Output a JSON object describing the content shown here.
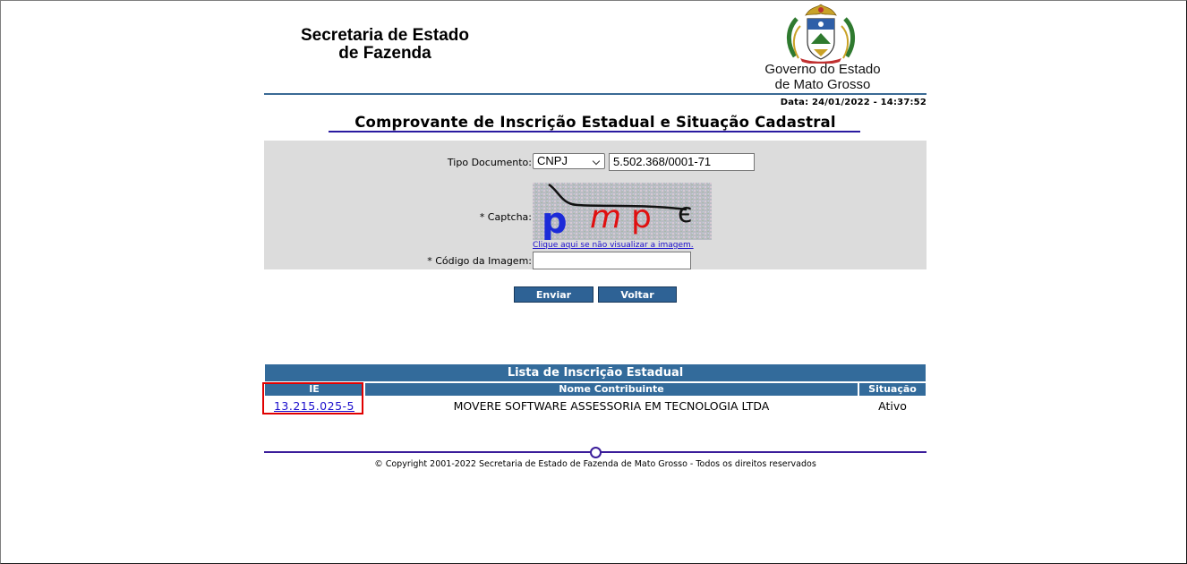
{
  "header": {
    "org_line1": "Secretaria de Estado",
    "org_line2": "de Fazenda",
    "gov_line1": "Governo do Estado",
    "gov_line2": "de Mato Grosso",
    "date": "Data: 24/01/2022 - 14:37:52"
  },
  "page_title": "Comprovante de Inscrição Estadual e Situação Cadastral",
  "form": {
    "tipo_label": "Tipo Documento:",
    "tipo_value": "CNPJ",
    "document_value": "5.502.368/0001-71",
    "captcha_label": "* Captcha:",
    "captcha_chars": [
      "p",
      "m",
      "p",
      "є"
    ],
    "captcha_link": "Clique aqui se não visualizar a imagem.",
    "codigo_label": "* Código da Imagem:",
    "codigo_value": ""
  },
  "buttons": {
    "enviar": "Enviar",
    "voltar": "Voltar"
  },
  "results": {
    "title": "Lista de Inscrição Estadual",
    "columns": [
      "IE",
      "Nome Contribuinte",
      "Situação"
    ],
    "rows": [
      {
        "ie": "13.215.025-5",
        "nome": "MOVERE SOFTWARE ASSESSORIA EM TECNOLOGIA LTDA",
        "situacao": "Ativo"
      }
    ]
  },
  "footer": {
    "copyright": "© Copyright 2001-2022 Secretaria de Estado de Fazenda de Mato Grosso - Todos os direitos reservados"
  },
  "colors": {
    "primary_blue": "#336b9b",
    "title_underline": "#2a1aa0",
    "highlight": "#e00000",
    "panel_gray": "#dcdcdc"
  }
}
